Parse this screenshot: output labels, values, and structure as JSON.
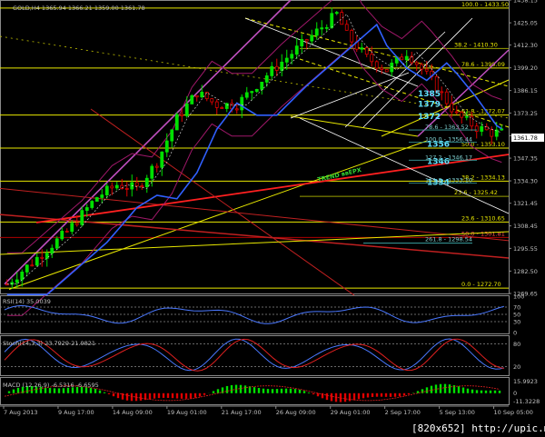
{
  "main_panel": {
    "symbol_header": "GOLD,H4 1365.94 1366.21 1359.00 1361.78",
    "current_price": "1361.78",
    "price_scale": [
      "1438.15",
      "1425.05",
      "1412.30",
      "1399.20",
      "1386.15",
      "1373.25",
      "1360.15",
      "1347.35",
      "1334.30",
      "1321.45",
      "1308.45",
      "1295.55",
      "1282.50",
      "1269.65"
    ],
    "fib_levels": [
      {
        "label": "100.0 - 1433.50",
        "value": 1433.5,
        "color": "#e8e800"
      },
      {
        "label": "38.2 - 1410.30",
        "value": 1410.3,
        "color": "#9aa000"
      },
      {
        "label": "78.6 - 1399.09",
        "value": 1399.09,
        "color": "#e8e800"
      },
      {
        "label": "61.8 - 1372.07",
        "value": 1372.07,
        "color": "#e8e800"
      },
      {
        "label": "50.0 - 1353.10",
        "value": 1353.1,
        "color": "#e8e800"
      },
      {
        "label": "38.2 - 1334.13",
        "value": 1334.13,
        "color": "#e8e800"
      },
      {
        "label": "23.6 - 1325.42",
        "value": 1325.42,
        "color": "#9aa000"
      },
      {
        "label": "23.6 - 1310.65",
        "value": 1310.65,
        "color": "#e8e800"
      },
      {
        "label": "50.0 - 1301.81",
        "value": 1301.81,
        "color": "#b00000"
      },
      {
        "label": "261.8 - 1298.54",
        "value": 1298.54,
        "color": "#3aa0a0"
      },
      {
        "label": "0.0 - 1272.70",
        "value": 1272.7,
        "color": "#e8e800"
      }
    ],
    "cyan_fib_labels": [
      {
        "label": "1385",
        "value": 1385,
        "big": true
      },
      {
        "label": "1379",
        "value": 1379,
        "big": true
      },
      {
        "label": "1372",
        "value": 1372,
        "big": true
      },
      {
        "label": "1356",
        "value": 1356,
        "big": true
      },
      {
        "label": "1346",
        "value": 1346,
        "big": true
      },
      {
        "label": "1334",
        "value": 1334,
        "big": true
      },
      {
        "label": "78.6 - 1363.52",
        "value": 1363.52,
        "big": false
      },
      {
        "label": "100.0 - 1356.44",
        "value": 1356.44,
        "big": false
      },
      {
        "label": "127.2 - 1346.17",
        "value": 1346.17,
        "big": false
      },
      {
        "label": "161.8 - 1333.10",
        "value": 1333.1,
        "big": false
      }
    ],
    "trend_label": "TREND ввЕРХ"
  },
  "rsi_panel": {
    "label": "RSI(14) 35.0039",
    "scale": [
      "100",
      "70",
      "50",
      "30",
      "0"
    ]
  },
  "stoch_panel": {
    "label": "Stoch(14,3,3) 23.7929 21.9821",
    "scale": [
      "80",
      "20"
    ]
  },
  "macd_panel": {
    "label": "MACD (12,26,9) -6.5316 -6.6595",
    "scale": [
      "15.9923",
      "0",
      "-11.3228"
    ]
  },
  "time_axis": [
    "7 Aug 2013",
    "9 Aug 17:00",
    "14 Aug 09:00",
    "19 Aug 01:00",
    "21 Aug 17:00",
    "26 Aug 09:00",
    "29 Aug 01:00",
    "2 Sep 17:00",
    "5 Sep 13:00",
    "10 Sep 05:00"
  ],
  "watermark": "[820x652] http://upic.me/",
  "chart_data": {
    "type": "line",
    "title": "GOLD,H4",
    "x": [
      "7 Aug 2013",
      "9 Aug 17:00",
      "14 Aug 09:00",
      "19 Aug 01:00",
      "21 Aug 17:00",
      "26 Aug 09:00",
      "29 Aug 01:00",
      "2 Sep 17:00",
      "5 Sep 13:00",
      "10 Sep 05:00"
    ],
    "series": [
      {
        "name": "GOLD,H4",
        "values": [
          1282,
          1300,
          1332,
          1372,
          1380,
          1420,
          1395,
          1412,
          1380,
          1362
        ]
      }
    ],
    "ylim": [
      1269.65,
      1438.15
    ],
    "grid": false
  }
}
